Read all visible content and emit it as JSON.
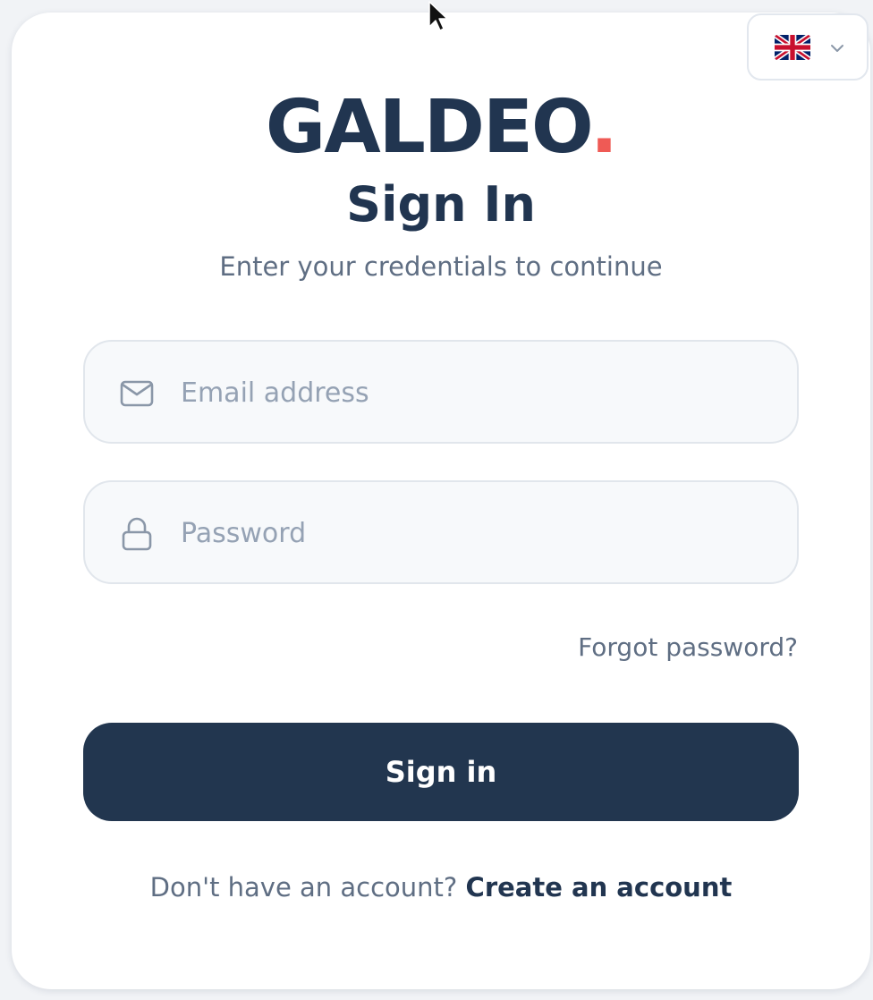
{
  "language_selector": {
    "flag": "uk-flag-icon",
    "chevron": "chevron-down-icon"
  },
  "brand": {
    "name": "GALDEO",
    "dot": ".",
    "accent_color": "#ef5a55",
    "primary_color": "#213550"
  },
  "heading": {
    "title": "Sign In",
    "subtitle": "Enter your credentials to continue"
  },
  "form": {
    "email": {
      "icon": "mail-icon",
      "placeholder": "Email address",
      "value": ""
    },
    "password": {
      "icon": "lock-icon",
      "placeholder": "Password",
      "value": ""
    },
    "forgot_password": "Forgot password?",
    "submit_label": "Sign in"
  },
  "footer": {
    "prompt": "Don't have an account?",
    "link": "Create an account"
  }
}
